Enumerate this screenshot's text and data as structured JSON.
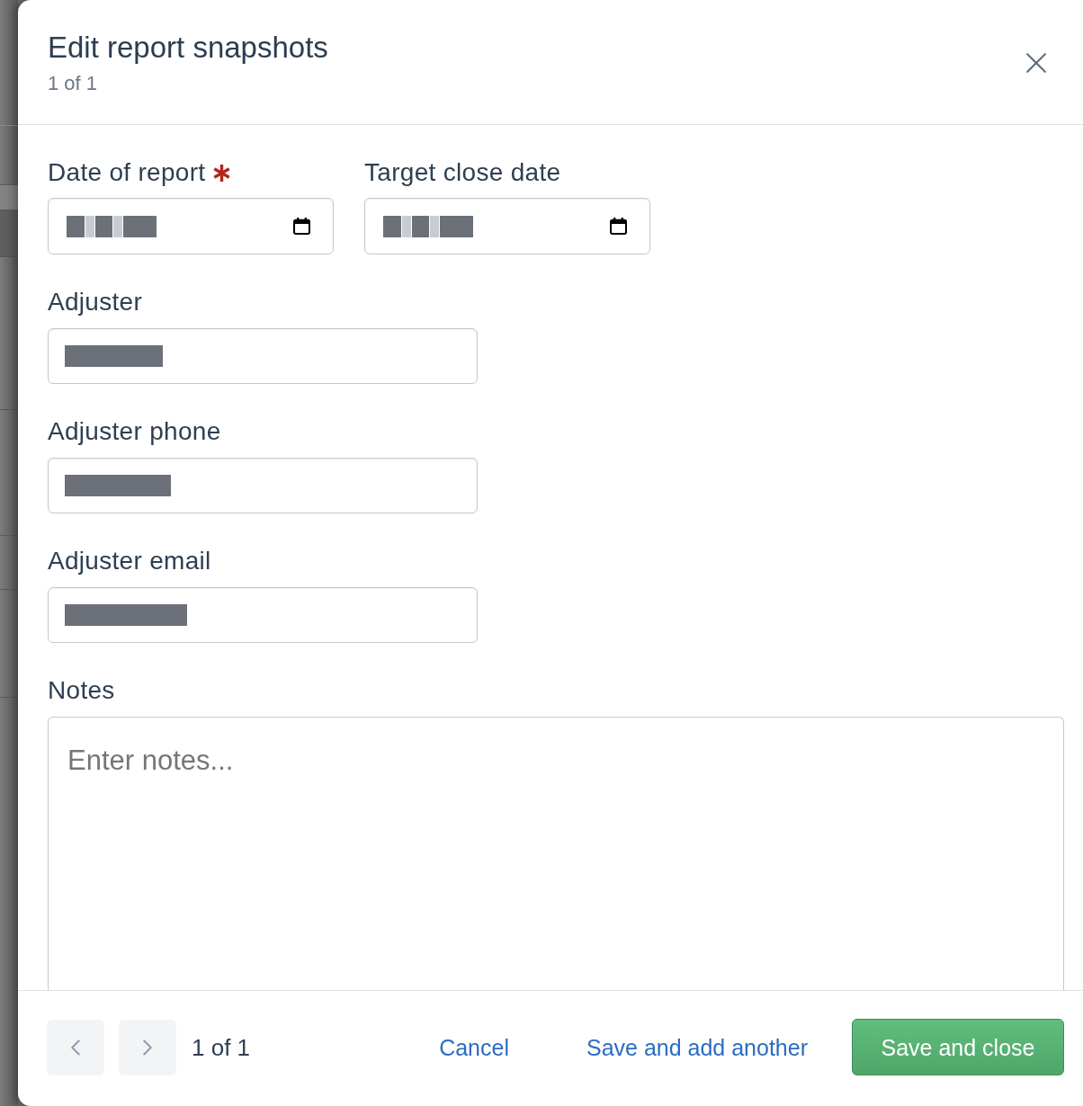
{
  "dialog": {
    "title": "Edit report snapshots",
    "subtitle": "1 of 1"
  },
  "fields": [
    {
      "kind": "date",
      "label": "Date of report",
      "required": true,
      "value_redacted": true
    },
    {
      "kind": "date",
      "label": "Target close date",
      "required": false,
      "value_redacted": true
    },
    {
      "kind": "text",
      "label": "Adjuster",
      "required": false,
      "value_redacted": true
    },
    {
      "kind": "text",
      "label": "Adjuster phone",
      "required": false,
      "value_redacted": true
    },
    {
      "kind": "text",
      "label": "Adjuster email",
      "required": false,
      "value_redacted": true
    },
    {
      "kind": "textarea",
      "label": "Notes",
      "required": false,
      "placeholder": "Enter notes..."
    }
  ],
  "footer": {
    "pager": {
      "buttons": [
        {
          "kind": "previous",
          "disabled": true
        },
        {
          "kind": "next",
          "disabled": true
        }
      ],
      "position": "1 of 1"
    },
    "actions": [
      {
        "kind": "link",
        "label": "Cancel"
      },
      {
        "kind": "link",
        "label": "Save and add another"
      },
      {
        "kind": "primary",
        "label": "Save and close"
      }
    ]
  }
}
